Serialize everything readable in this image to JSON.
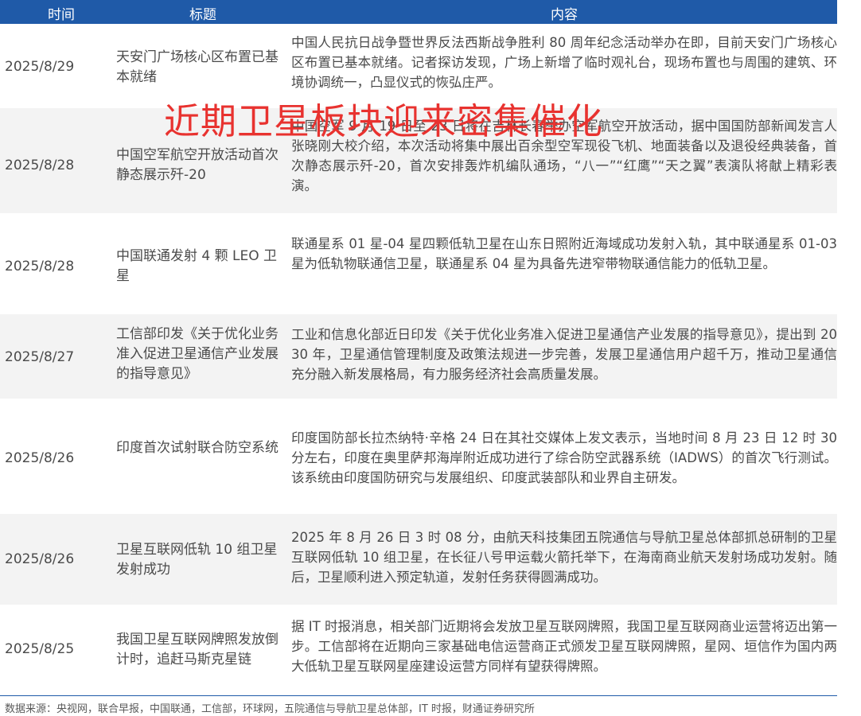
{
  "header": {
    "time": "时间",
    "title": "标题",
    "content": "内容"
  },
  "overlay_title": "近期卫星板块迎来密集催化",
  "rows": [
    {
      "date": "2025/8/29",
      "title": "天安门广场核心区布置已基本就绪",
      "content": "中国人民抗日战争暨世界反法西斯战争胜利 80 周年纪念活动举办在即，目前天安门广场核心区布置已基本就绪。记者探访发现，广场上新增了临时观礼台，现场布置也与周围的建筑、环境协调统一，凸显仪式的恢弘庄严。"
    },
    {
      "date": "2025/8/28",
      "title": "中国空军航空开放活动首次静态展示歼-20",
      "content": "中国空军 9 月 19 日至 23 日将在吉林长春举办空军航空开放活动，据中国国防部新闻发言人张晓刚大校介绍，本次活动将集中展出百余型空军现役飞机、地面装备以及退役经典装备，首次静态展示歼-20，首次安排轰炸机编队通场，“八一”“红鹰”“天之翼”表演队将献上精彩表演。"
    },
    {
      "date": "2025/8/28",
      "title": "中国联通发射 4 颗 LEO 卫星",
      "content": "联通星系 01 星-04 星四颗低轨卫星在山东日照附近海域成功发射入轨，其中联通星系 01-03 星为低轨物联通信卫星，联通星系 04 星为具备先进窄带物联通信能力的低轨卫星。"
    },
    {
      "date": "2025/8/27",
      "title": "工信部印发《关于优化业务准入促进卫星通信产业发展的指导意见》",
      "content": "工业和信息化部近日印发《关于优化业务准入促进卫星通信产业发展的指导意见》，提出到 2030 年，卫星通信管理制度及政策法规进一步完善，发展卫星通信用户超千万，推动卫星通信充分融入新发展格局，有力服务经济社会高质量发展。"
    },
    {
      "date": "2025/8/26",
      "title": "印度首次试射联合防空系统",
      "content": "印度国防部长拉杰纳特·辛格 24 日在其社交媒体上发文表示，当地时间 8 月 23 日 12 时 30 分左右，印度在奥里萨邦海岸附近成功进行了综合防空武器系统（IADWS）的首次飞行测试。该系统由印度国防研究与发展组织、印度武装部队和业界自主研发。"
    },
    {
      "date": "2025/8/26",
      "title": "卫星互联网低轨 10 组卫星发射成功",
      "content": "2025 年 8 月 26 日 3 时 08 分，由航天科技集团五院通信与导航卫星总体部抓总研制的卫星互联网低轨 10 组卫星，在长征八号甲运载火箭托举下，在海南商业航天发射场成功发射。随后，卫星顺利进入预定轨道，发射任务获得圆满成功。"
    },
    {
      "date": "2025/8/25",
      "title": "我国卫星互联网牌照发放倒计时，追赶马斯克星链",
      "content": "据 IT 时报消息，相关部门近期将会发放卫星互联网牌照，我国卫星互联网商业运营将迈出第一步。工信部将在近期向三家基础电信运营商正式颁发卫星互联网牌照，星网、垣信作为国内两大低轨卫星互联网星座建设运营方同样有望获得牌照。"
    }
  ],
  "source": "数据来源：央视网，联合早报，中国联通，工信部，环球网，五院通信与导航卫星总体部，IT 时报，财通证券研究所"
}
